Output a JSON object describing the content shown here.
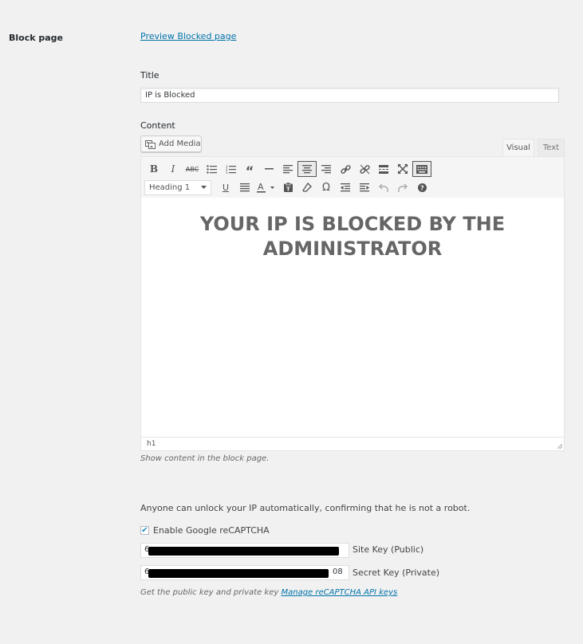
{
  "section_label": "Block page",
  "preview_link": "Preview Blocked page",
  "title_field": {
    "label": "Title",
    "value": "IP is Blocked"
  },
  "content_field": {
    "label": "Content",
    "add_media_label": "Add Media",
    "tabs": {
      "visual": "Visual",
      "text": "Text"
    },
    "active_tab": "Visual",
    "format_select": "Heading 1",
    "active_alignment": "center",
    "heading_text": "YOUR IP IS BLOCKED BY THE ADMINISTRATOR",
    "status_path": "h1",
    "description": "Show content in the block page."
  },
  "toolbar_icons": {
    "row1": [
      "bold-icon",
      "italic-icon",
      "strikethrough-icon",
      "bullet-list-icon",
      "numbered-list-icon",
      "blockquote-icon",
      "horizontal-line-icon",
      "align-left-icon",
      "align-center-icon",
      "align-right-icon",
      "link-icon",
      "unlink-icon",
      "read-more-icon",
      "fullscreen-icon",
      "toolbar-toggle-icon"
    ],
    "row2": [
      "underline-icon",
      "justify-icon",
      "text-color-icon",
      "paste-text-icon",
      "clear-formatting-icon",
      "special-character-icon",
      "outdent-icon",
      "indent-icon",
      "undo-icon",
      "redo-icon",
      "help-icon"
    ]
  },
  "recaptcha": {
    "intro": "Anyone can unlock your IP automatically, confirming that he is not a robot.",
    "enable_label": "Enable Google reCAPTCHA",
    "enabled": true,
    "site_key_label": "Site Key (Public)",
    "site_key_value": "6",
    "secret_key_label": "Secret Key (Private)",
    "secret_key_value": "6",
    "secret_key_suffix": "08",
    "footer_text": "Get the public key and private key",
    "footer_link": "Manage reCAPTCHA API keys"
  },
  "colors": {
    "link": "#0073aa",
    "background": "#f1f1f1",
    "heading": "#666666",
    "checkbox_check": "#1e8cbe"
  }
}
